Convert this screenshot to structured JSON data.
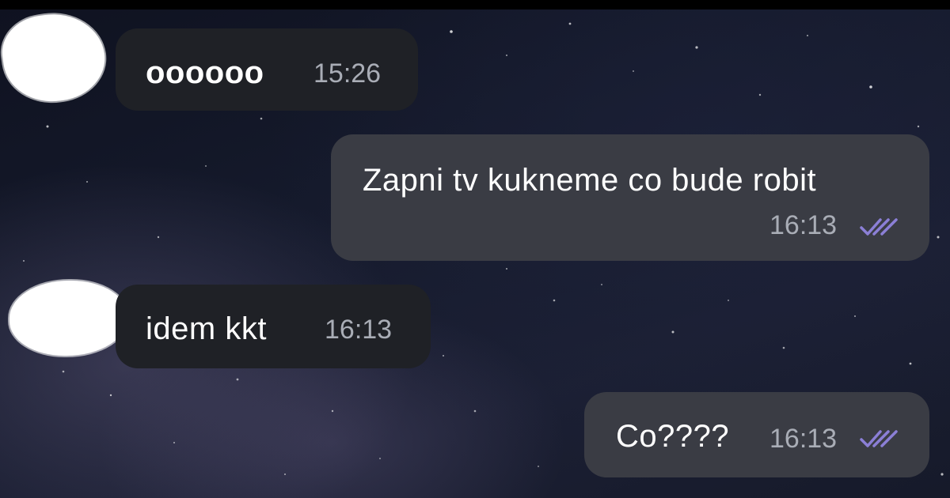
{
  "chat": {
    "messages": [
      {
        "direction": "incoming",
        "text": "оооооо",
        "time": "15:26"
      },
      {
        "direction": "outgoing",
        "text": "Zapni tv kukneme co bude robit",
        "time": "16:13",
        "status_icon": "double-check-icon"
      },
      {
        "direction": "incoming",
        "text": "idem kkt",
        "time": "16:13"
      },
      {
        "direction": "outgoing",
        "text": "Co????",
        "time": "16:13",
        "status_icon": "double-check-icon"
      }
    ]
  },
  "colors": {
    "incoming_bubble": "#1f2126",
    "outgoing_bubble": "#3a3c44",
    "read_tick": "#8b7fd6",
    "time_text": "#a9adb6"
  }
}
